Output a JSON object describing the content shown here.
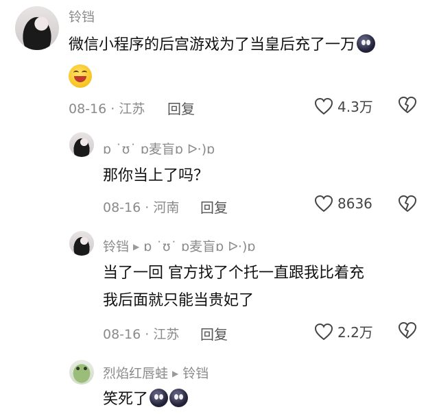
{
  "comments": [
    {
      "username": "铃铛",
      "text": "微信小程序的后宫游戏为了当皇后充了一万",
      "date_location": "08-16 · 江苏",
      "reply_label": "回复",
      "likes": "4.3万"
    },
    {
      "username": "ɒ ˙ʊ˙ ɒ麦盲ɒ ᐅ·)ɒ",
      "text": "那你当上了吗？",
      "date_location": "08-16 · 河南",
      "reply_label": "回复",
      "likes": "8636"
    },
    {
      "username": "铃铛",
      "reply_to": "ɒ ˙ʊ˙ ɒ麦盲ɒ ᐅ·)ɒ",
      "text_line1": "当了一回  官方找了个托一直跟我比着充",
      "text_line2": "我后面就只能当贵妃了",
      "date_location": "08-16 · 江苏",
      "reply_label": "回复",
      "likes": "2.2万"
    },
    {
      "username": "烈焰红唇蛙",
      "reply_to": "铃铛",
      "text": "笑死了"
    }
  ]
}
